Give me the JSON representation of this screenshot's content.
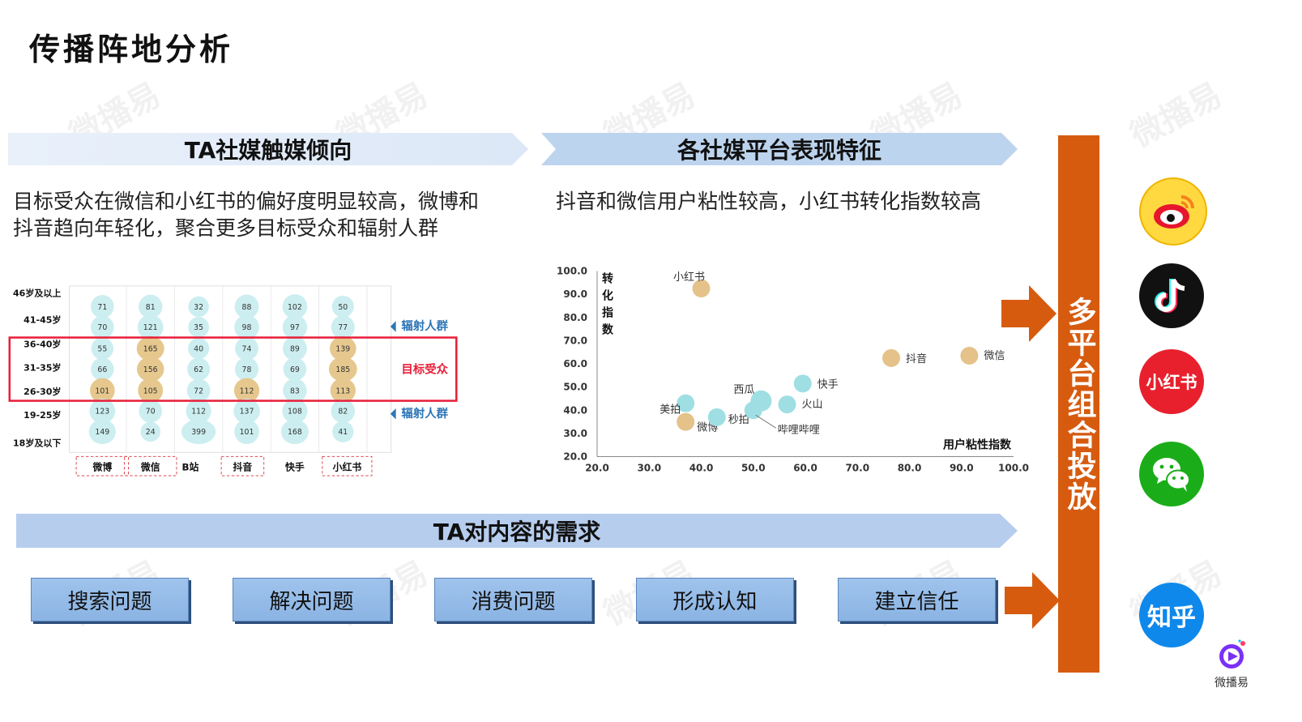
{
  "page_title": "传播阵地分析",
  "watermark_text": "微播易",
  "banners": {
    "left": "TA社媒触媒倾向",
    "middle": "各社媒平台表现特征",
    "bottom": "TA对内容的需求"
  },
  "descriptions": {
    "left_line1": "目标受众在微信和小红书的偏好度明显较高，微博和",
    "left_line2": "抖音趋向年轻化，聚合更多目标受众和辐射人群",
    "middle": "抖音和微信用户粘性较高，小红书转化指数较高"
  },
  "bubble_chart": {
    "age_groups": [
      "46岁及以上",
      "41-45岁",
      "36-40岁",
      "31-35岁",
      "26-30岁",
      "19-25岁",
      "18岁及以下"
    ],
    "platforms": [
      "微博",
      "微信",
      "B站",
      "抖音",
      "快手",
      "小红书"
    ],
    "highlighted_platforms": [
      "微博",
      "微信",
      "抖音",
      "小红书"
    ],
    "values": [
      [
        71,
        81,
        32,
        88,
        102,
        50
      ],
      [
        70,
        121,
        35,
        98,
        97,
        77
      ],
      [
        55,
        165,
        40,
        74,
        89,
        139
      ],
      [
        66,
        156,
        62,
        78,
        69,
        185
      ],
      [
        101,
        105,
        72,
        112,
        83,
        113
      ],
      [
        123,
        70,
        112,
        137,
        108,
        82
      ],
      [
        149,
        24,
        399,
        101,
        168,
        41
      ]
    ],
    "target_rows": [
      2,
      3,
      4
    ],
    "labels": {
      "radiation_top": "辐射人群",
      "target": "目标受众",
      "radiation_bottom": "辐射人群"
    },
    "colors": {
      "normal": "#cdeef0",
      "highlight": "#e6c88e",
      "target_box": "#e8203a",
      "label_blue": "#2e75b6",
      "label_red": "#e8203a"
    }
  },
  "chart_data": {
    "type": "scatter",
    "title": "",
    "xlabel": "用户粘性指数",
    "ylabel": "转化指数",
    "xlim": [
      20.0,
      100.0
    ],
    "ylim": [
      20.0,
      100.0
    ],
    "x_ticks": [
      "20.0",
      "30.0",
      "40.0",
      "50.0",
      "60.0",
      "70.0",
      "80.0",
      "90.0",
      "100.0"
    ],
    "y_ticks": [
      "20.0",
      "30.0",
      "40.0",
      "50.0",
      "60.0",
      "70.0",
      "80.0",
      "90.0",
      "100.0"
    ],
    "points": [
      {
        "label": "小红书",
        "x": 40.0,
        "y": 92.5,
        "group": "gold"
      },
      {
        "label": "抖音",
        "x": 76.5,
        "y": 62.5,
        "group": "gold"
      },
      {
        "label": "微信",
        "x": 91.5,
        "y": 63.5,
        "group": "gold"
      },
      {
        "label": "快手",
        "x": 59.5,
        "y": 51.5,
        "group": "teal"
      },
      {
        "label": "火山",
        "x": 56.5,
        "y": 42.5,
        "group": "teal"
      },
      {
        "label": "西瓜",
        "x": 51.5,
        "y": 44.0,
        "group": "teal"
      },
      {
        "label": "美拍",
        "x": 37.0,
        "y": 43.0,
        "group": "teal"
      },
      {
        "label": "微博",
        "x": 37.0,
        "y": 35.0,
        "group": "gold"
      },
      {
        "label": "秒拍",
        "x": 43.0,
        "y": 37.0,
        "group": "teal"
      },
      {
        "label": "哔哩哔哩",
        "x": 50.0,
        "y": 40.0,
        "group": "teal"
      }
    ],
    "colors": {
      "gold": "#e4c28a",
      "teal": "#9fdfe3"
    },
    "grid": false
  },
  "needs": [
    "搜索问题",
    "解决问题",
    "消费问题",
    "形成认知",
    "建立信任"
  ],
  "strategy": "多平台组合投放",
  "apps": [
    "weibo-icon",
    "douyin-icon",
    "xiaohongshu-icon",
    "wechat-icon",
    "zhihu-icon"
  ],
  "app_labels": {
    "xiaohongshu": "小红书",
    "zhihu": "知乎"
  },
  "brand_logo_text": "微播易",
  "colors": {
    "orange": "#d65b0f",
    "banner_blue": "#bcd3ef",
    "need_blue": "#8bb4e4"
  }
}
